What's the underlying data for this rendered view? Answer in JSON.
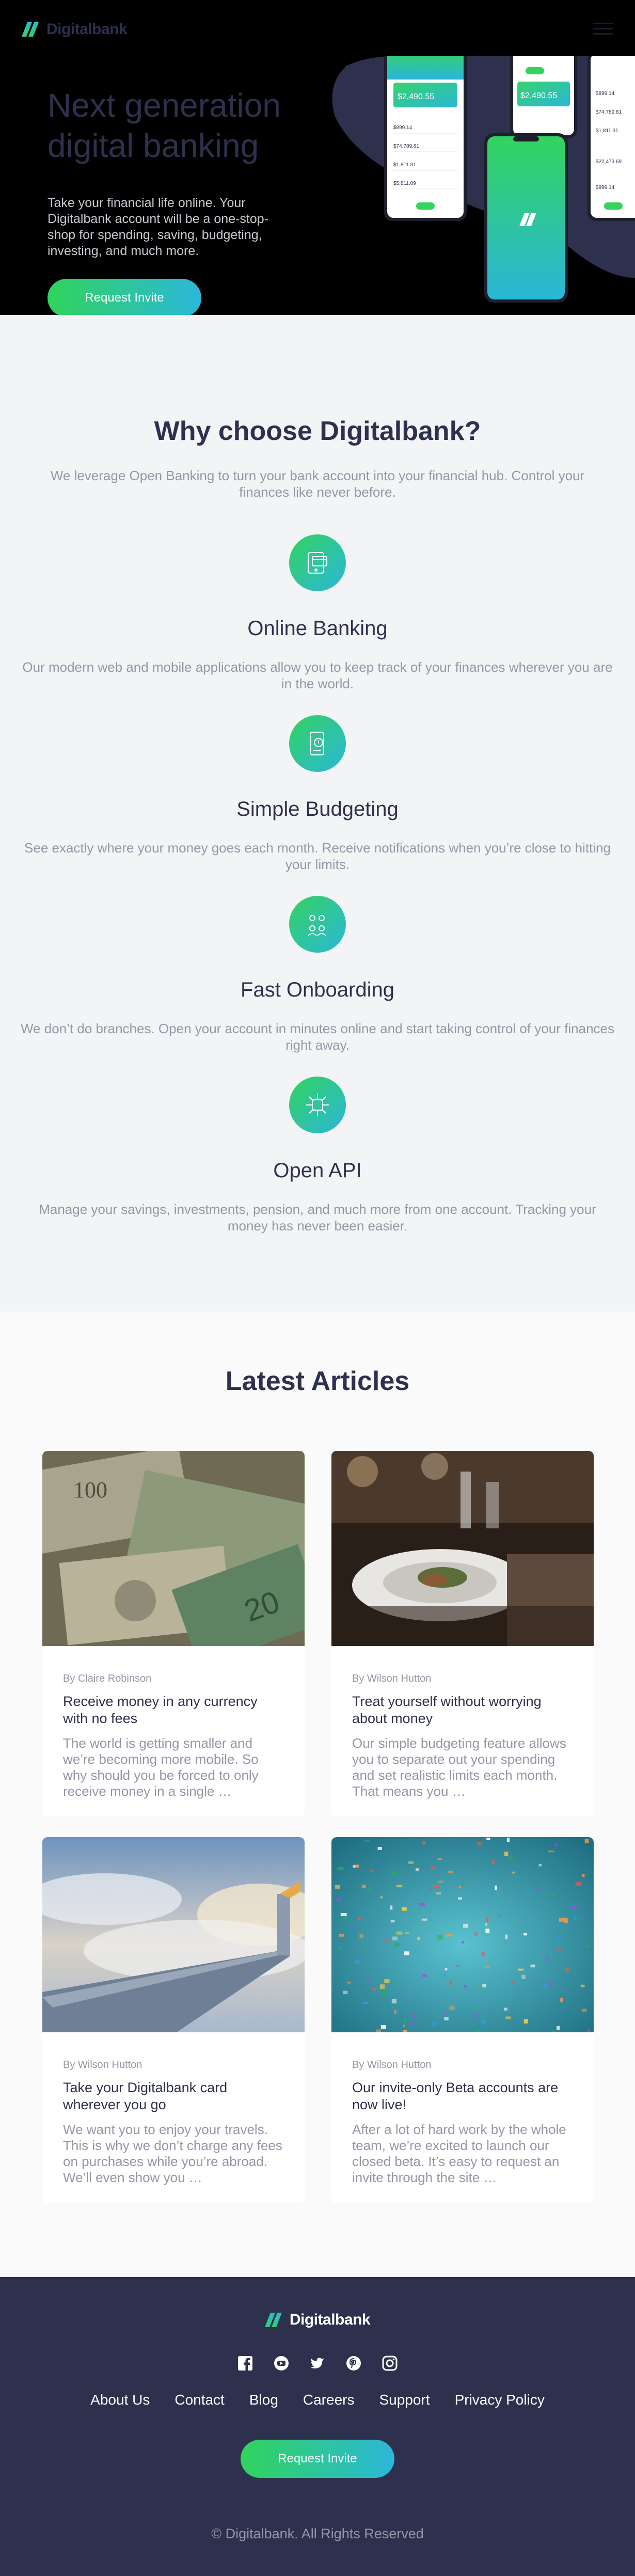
{
  "brand": {
    "name": "Digitalbank",
    "colors": {
      "dark_blue": "#2d314d",
      "lime_green": "#31d35c",
      "bright_cyan": "#2bb7da",
      "grayish_blue": "#9597a6"
    }
  },
  "nav": {
    "menu_icon": "hamburger-icon"
  },
  "hero": {
    "title": "Next generation digital banking",
    "copy": "Take your financial life online. Your Digitalbank account will be a one-stop-shop for spending, saving, budgeting, investing, and much more.",
    "cta_label": "Request Invite",
    "phone_balance_1": "$2,490.55",
    "phone_balance_2": "$2,490.55",
    "phone_rows": [
      "$899.14",
      "$74.789.81",
      "$1,811.31",
      "$5,811.09",
      "$22,473.69"
    ]
  },
  "why": {
    "title": "Why choose Digitalbank?",
    "subtitle": "We leverage Open Banking to turn your bank account into your financial hub. Control your finances like never before.",
    "features": [
      {
        "icon": "online-banking-icon",
        "title": "Online Banking",
        "text": "Our modern web and mobile applications allow you to keep track of your finances wherever you are in the world."
      },
      {
        "icon": "budgeting-icon",
        "title": "Simple Budgeting",
        "text": "See exactly where your money goes each month. Receive notifications when you’re close to hitting your limits."
      },
      {
        "icon": "onboarding-icon",
        "title": "Fast Onboarding",
        "text": "We don’t do branches. Open your account in minutes online and start taking control of your finances right away."
      },
      {
        "icon": "api-icon",
        "title": "Open API",
        "text": "Manage your savings, investments, pension, and much more from one account. Tracking your money has never been easier."
      }
    ]
  },
  "articles": {
    "title": "Latest Articles",
    "items": [
      {
        "author": "By Claire Robinson",
        "title": "Receive money in any currency with no fees",
        "excerpt": "The world is getting smaller and we’re becoming more mobile. So why should you be forced to only receive money in a single …",
        "image": "currency-photo"
      },
      {
        "author": "By Wilson Hutton",
        "title": "Treat yourself without worrying about money",
        "excerpt": "Our simple budgeting feature allows you to separate out your spending and set realistic limits each month. That means you …",
        "image": "restaurant-photo"
      },
      {
        "author": "By Wilson Hutton",
        "title": "Take your Digitalbank card wherever you go",
        "excerpt": "We want you to enjoy your travels. This is why we don’t charge any fees on purchases while you’re abroad. We’ll even show you …",
        "image": "plane-photo"
      },
      {
        "author": "By Wilson Hutton",
        "title": "Our invite-only Beta accounts are now live!",
        "excerpt": "After a lot of hard work by the whole team, we’re excited to launch our closed beta. It’s easy to request an invite through the site …",
        "image": "confetti-photo"
      }
    ]
  },
  "footer": {
    "social": [
      "facebook-icon",
      "youtube-icon",
      "twitter-icon",
      "pinterest-icon",
      "instagram-icon"
    ],
    "links": [
      "About Us",
      "Contact",
      "Blog",
      "Careers",
      "Support",
      "Privacy Policy"
    ],
    "cta_label": "Request Invite",
    "copyright": "© Digitalbank. All Rights Reserved"
  }
}
